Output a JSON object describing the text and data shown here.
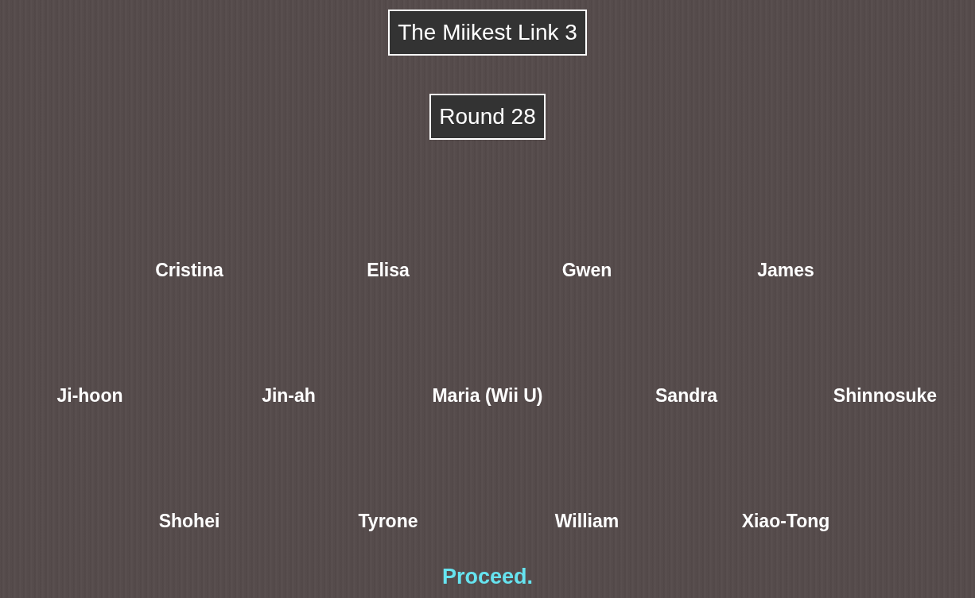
{
  "title": "The Miikest Link 3",
  "round": "Round 28",
  "contestant_rows": [
    {
      "names": [
        "Cristina",
        "Elisa",
        "Gwen",
        "James"
      ]
    },
    {
      "names": [
        "Ji-hoon",
        "Jin-ah",
        "Maria (Wii U)",
        "Sandra",
        "Shinnosuke"
      ]
    },
    {
      "names": [
        "Shohei",
        "Tyrone",
        "William",
        "Xiao-Tong"
      ]
    }
  ],
  "proceed_link": "Proceed."
}
